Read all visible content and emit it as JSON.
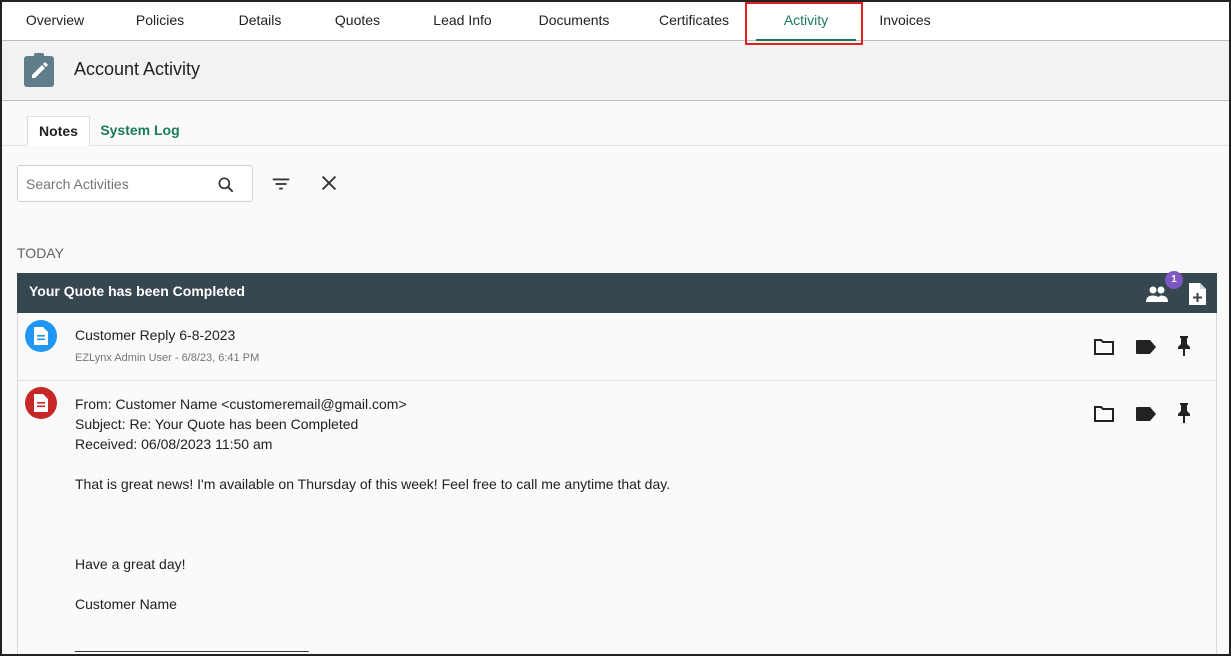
{
  "nav": {
    "tabs": [
      "Overview",
      "Policies",
      "Details",
      "Quotes",
      "Lead Info",
      "Documents",
      "Certificates",
      "Activity",
      "Invoices"
    ],
    "active": "Activity"
  },
  "header": {
    "title": "Account Activity"
  },
  "subtabs": {
    "notes": "Notes",
    "system_log": "System Log"
  },
  "search": {
    "placeholder": "Search Activities",
    "value": ""
  },
  "section_label": "TODAY",
  "activity": {
    "title": "Your Quote has been Completed",
    "participant_count": "1",
    "entries": [
      {
        "title": "Customer Reply 6-8-2023",
        "meta": "EZLynx Admin User - 6/8/23, 6:41 PM"
      }
    ],
    "email": {
      "from": "From: Customer Name <customeremail@gmail.com>",
      "subject": "Subject: Re: Your Quote has been Completed",
      "received": "Received: 06/08/2023 11:50 am",
      "body": "That is great news! I'm available on Thursday of this week! Feel free to call me anytime that day.",
      "closing": "Have a great day!",
      "signature": "Customer Name",
      "rule": "______________________________"
    }
  },
  "colors": {
    "accent": "#1b7a5a",
    "card_header": "#37474f",
    "note_icon": "#2196f3",
    "email_icon": "#c62828",
    "badge": "#7e57c2",
    "highlight": "#e02020"
  }
}
